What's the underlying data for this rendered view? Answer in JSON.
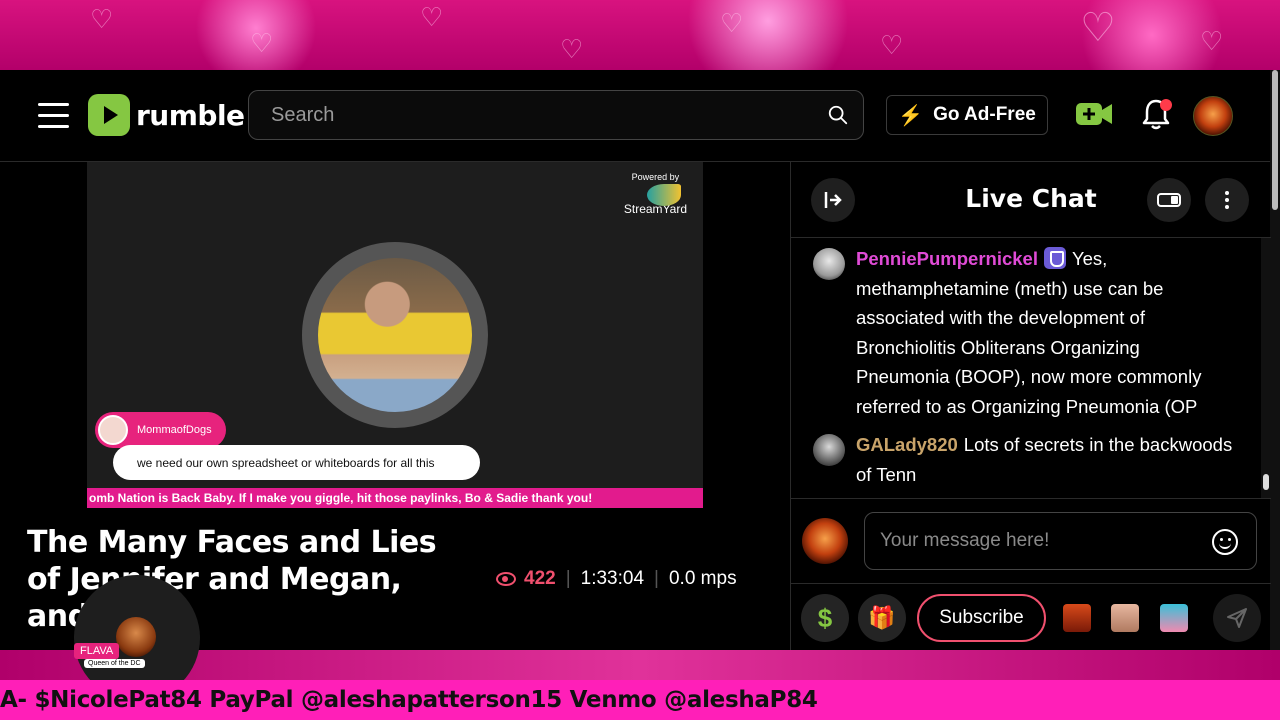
{
  "header": {
    "logo_text": "rumble",
    "search_placeholder": "Search",
    "ad_free_label": "Go Ad-Free",
    "icons": [
      "menu-icon",
      "search-icon",
      "bolt-icon",
      "go-live-camera-icon",
      "bell-icon"
    ]
  },
  "video": {
    "powered_by": "Powered by",
    "streamyard_label": "StreamYard",
    "commenter_name": "MommaofDogs",
    "comment_text": "we need our own spreadsheet or whiteboards for all this",
    "ticker_text": "omb Nation is Back Baby. If I make you giggle, hit those paylinks, Bo & Sadie thank you!",
    "title": "The Many Faces and Lies of Jennifer and Megan, and Co",
    "views": "422",
    "duration": "1:33:04",
    "mps": "0.0 mps"
  },
  "flava": {
    "tag": "FLAVA",
    "subtitle": "Queen of the DC"
  },
  "chat": {
    "title": "Live Chat",
    "messages": [
      {
        "username": "PenniePumpernickel",
        "user_color": "#e04bd6",
        "text": "Yes, methamphetamine (meth) use can be associated with the development of Bronchiolitis Obliterans Organizing Pneumonia (BOOP), now more commonly referred to as Organizing Pneumonia (OP"
      },
      {
        "username": "GALady820",
        "user_color": "#c9a46a",
        "text": "Lots of secrets in the backwoods of Tenn"
      }
    ],
    "input_placeholder": "Your message here!",
    "subscribe_label": "Subscribe",
    "dollar_symbol": "$",
    "gift_symbol": "🎁"
  },
  "banner_text": "A- $NicolePat84 PayPal @aleshapatterson15 Venmo @aleshaP84",
  "colors": {
    "brand_green": "#85c742",
    "accent_red": "#f0506e",
    "pink": "#e7237d"
  }
}
